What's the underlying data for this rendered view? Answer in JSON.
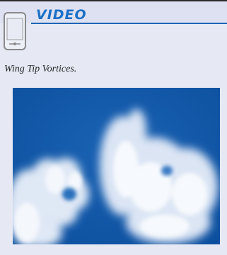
{
  "header": {
    "label": "VIDEO",
    "icon": "mobile-device-icon"
  },
  "figure": {
    "caption": "Wing Tip Vortices.",
    "image": "photo-wing-tip-vortices-clouds"
  },
  "colors": {
    "accent": "#1d6fc7",
    "sky": "#0f57a9",
    "background": "#e6e9f4"
  }
}
